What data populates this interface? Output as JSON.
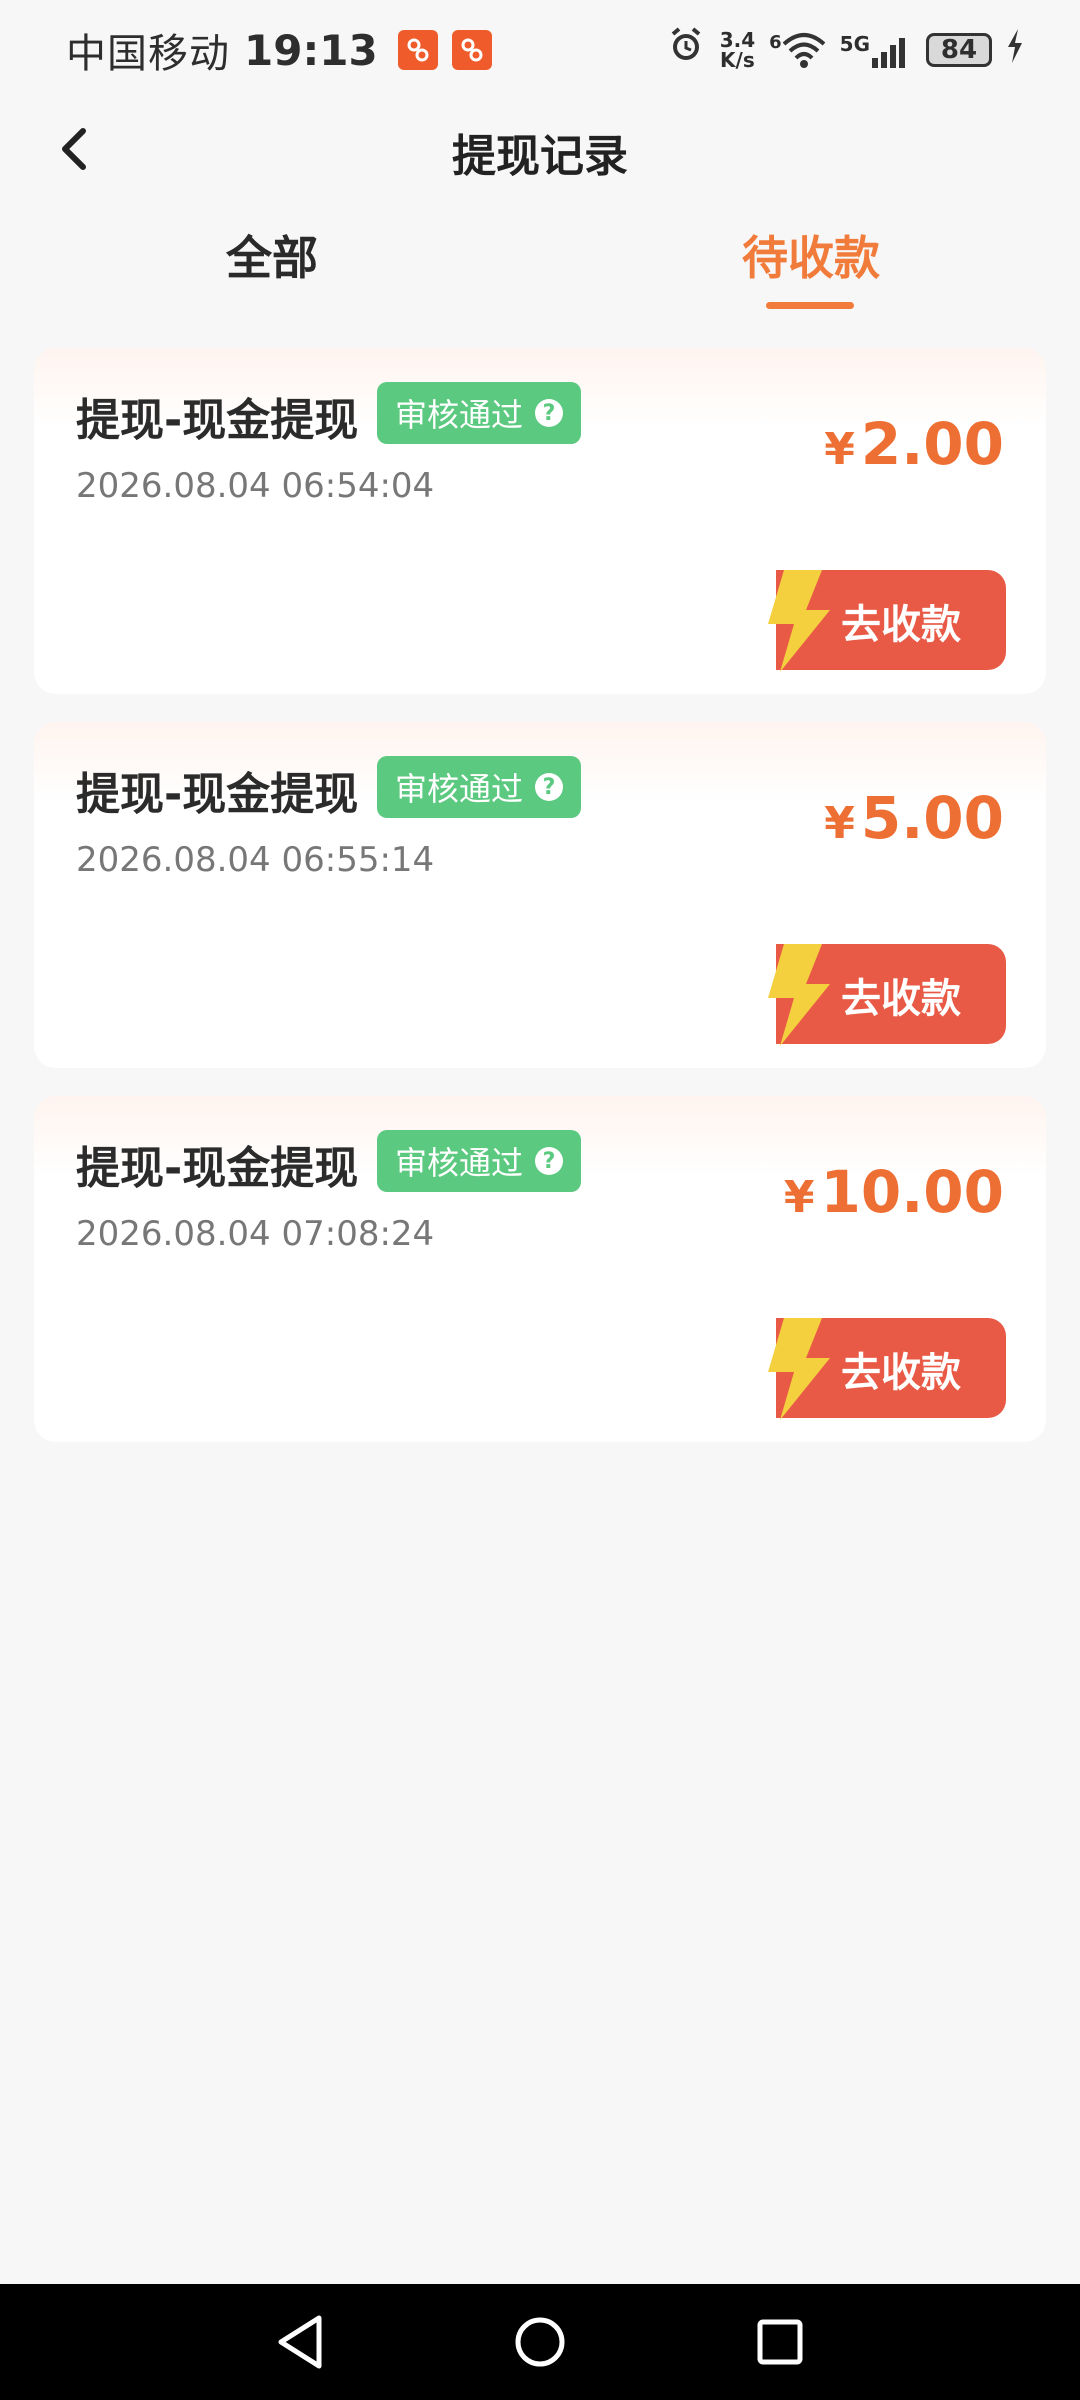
{
  "status_bar": {
    "carrier": "中国移动",
    "time": "19:13",
    "net_speed_value": "3.4",
    "net_speed_unit": "K/s",
    "signal_label": "5G",
    "wifi_label": "6",
    "battery": "84"
  },
  "header": {
    "title": "提现记录"
  },
  "tabs": {
    "all": "全部",
    "pending": "待收款"
  },
  "records": [
    {
      "title": "提现-现金提现",
      "status": "审核通过",
      "time": "2026.08.04 06:54:04",
      "currency": "¥",
      "amount": "2.00",
      "button": "去收款"
    },
    {
      "title": "提现-现金提现",
      "status": "审核通过",
      "time": "2026.08.04 06:55:14",
      "currency": "¥",
      "amount": "5.00",
      "button": "去收款"
    },
    {
      "title": "提现-现金提现",
      "status": "审核通过",
      "time": "2026.08.04 07:08:24",
      "currency": "¥",
      "amount": "10.00",
      "button": "去收款"
    }
  ],
  "colors": {
    "accent": "#f07b3a",
    "badge": "#5bc97f",
    "button": "#e85a45"
  }
}
